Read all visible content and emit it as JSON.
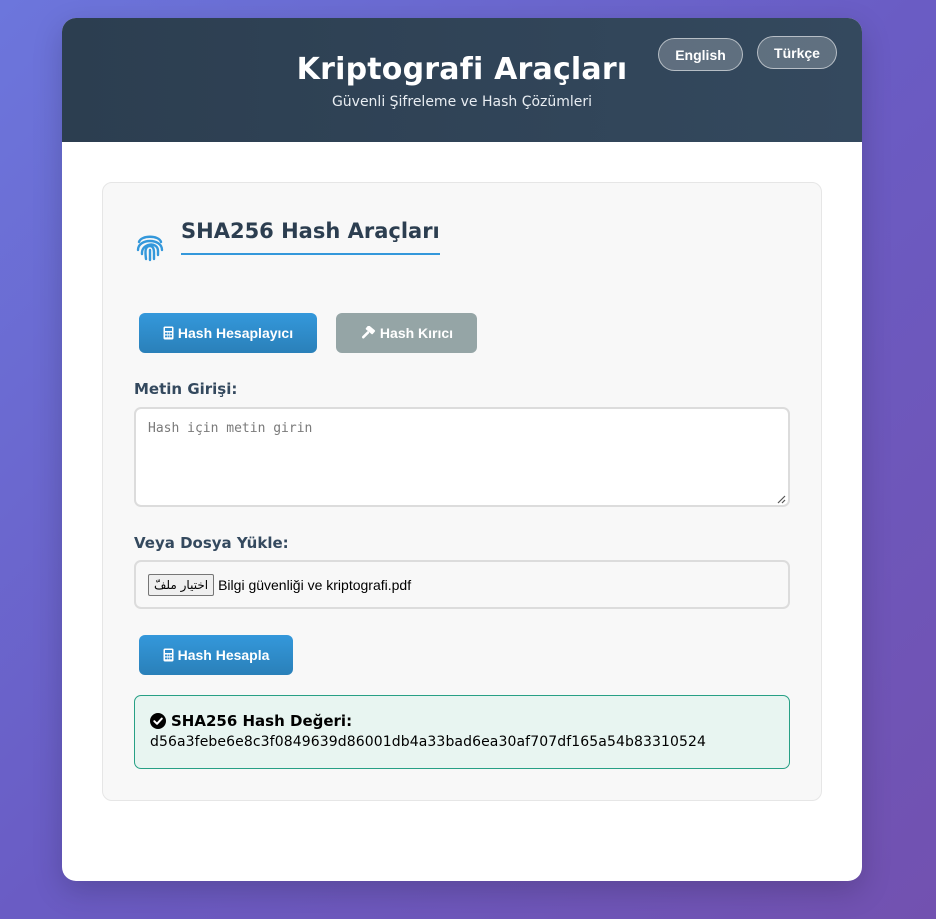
{
  "header": {
    "title": "Kriptografi Araçları",
    "subtitle": "Güvenli Şifreleme ve Hash Çözümleri",
    "lang_english": "English",
    "lang_turkish": "Türkçe"
  },
  "panel": {
    "title": "SHA256 Hash Araçları",
    "icon": "fingerprint-icon",
    "tabs": [
      {
        "label": "Hash Hesaplayıcı",
        "icon": "calculator-icon",
        "active": true
      },
      {
        "label": "Hash Kırıcı",
        "icon": "hammer-icon",
        "active": false
      }
    ]
  },
  "form": {
    "text_label": "Metin Girişi:",
    "text_placeholder": "Hash için metin girin",
    "text_value": "",
    "file_label": "Veya Dosya Yükle:",
    "file_button": "اختيار ملفّ",
    "file_name": "Bilgi güvenliği ve kriptografi.pdf",
    "submit_label": "Hash Hesapla"
  },
  "result": {
    "title": "SHA256 Hash Değeri:",
    "value": "d56a3febe6e8c3f0849639d86001db4a33bad6ea30af707df165a54b83310524",
    "icon": "check-circle-icon"
  },
  "colors": {
    "accent": "#3498db",
    "header_bg": "#2c3e50",
    "secondary_button": "#95a5a6",
    "success_border": "#27a085",
    "success_bg": "#e8f5f1"
  }
}
